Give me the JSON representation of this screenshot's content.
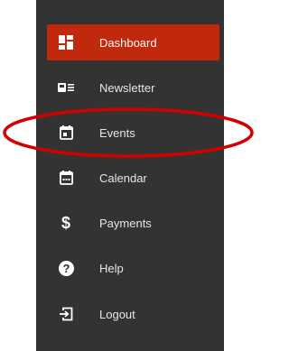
{
  "sidebar": {
    "items": [
      {
        "label": "Dashboard",
        "icon": "dashboard-icon",
        "active": true
      },
      {
        "label": "Newsletter",
        "icon": "newsletter-icon",
        "active": false
      },
      {
        "label": "Events",
        "icon": "event-icon",
        "active": false
      },
      {
        "label": "Calendar",
        "icon": "calendar-icon",
        "active": false
      },
      {
        "label": "Payments",
        "icon": "dollar-icon",
        "active": false
      },
      {
        "label": "Help",
        "icon": "help-icon",
        "active": false
      },
      {
        "label": "Logout",
        "icon": "logout-icon",
        "active": false
      }
    ]
  },
  "colors": {
    "sidebar_bg": "#333333",
    "active_bg": "#c0290c",
    "highlight_annotation": "#d40000"
  }
}
